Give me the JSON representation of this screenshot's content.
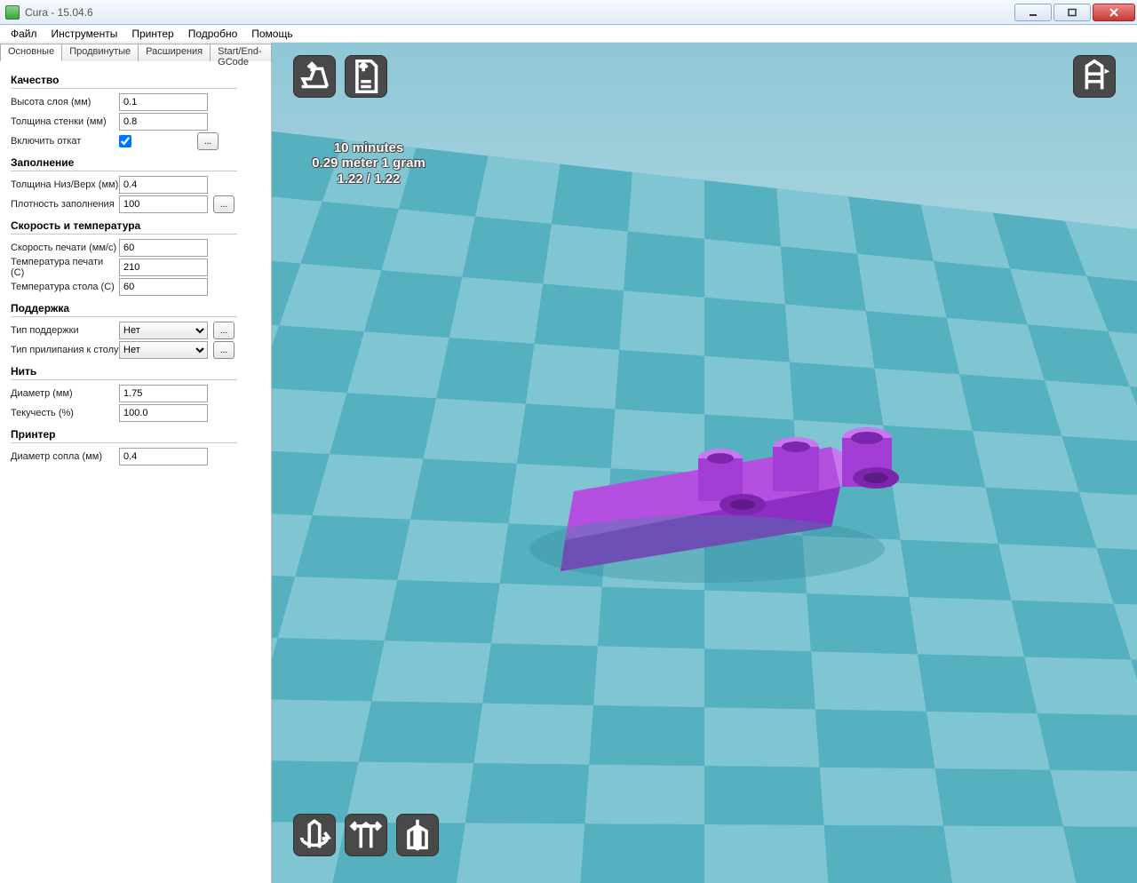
{
  "window": {
    "title": "Cura - 15.04.6"
  },
  "menu": [
    "Файл",
    "Инструменты",
    "Принтер",
    "Подробно",
    "Помощь"
  ],
  "tabs": [
    "Основные",
    "Продвинутые",
    "Расширения",
    "Start/End-GCode"
  ],
  "active_tab": 0,
  "settings": {
    "quality": {
      "title": "Качество",
      "layer_label": "Высота слоя (мм)",
      "layer_value": "0.1",
      "shell_label": "Толщина стенки (мм)",
      "shell_value": "0.8",
      "retract_label": "Включить откат",
      "retract_checked": true
    },
    "fill": {
      "title": "Заполнение",
      "topbot_label": "Толщина Низ/Верх (мм)",
      "topbot_value": "0.4",
      "density_label": "Плотность заполнения",
      "density_value": "100"
    },
    "speedtemp": {
      "title": "Скорость и температура",
      "speed_label": "Скорость печати (мм/с)",
      "speed_value": "60",
      "temp_label": "Температура печати (C)",
      "temp_value": "210",
      "bed_label": "Температура стола (C)",
      "bed_value": "60"
    },
    "support": {
      "title": "Поддержка",
      "type_label": "Тип поддержки",
      "type_value": "Нет",
      "adh_label": "Тип прилипания к столу",
      "adh_value": "Нет"
    },
    "filament": {
      "title": "Нить",
      "dia_label": "Диаметр (мм)",
      "dia_value": "1.75",
      "flow_label": "Текучесть (%)",
      "flow_value": "100.0"
    },
    "machine": {
      "title": "Принтер",
      "nozzle_label": "Диаметр сопла (мм)",
      "nozzle_value": "0.4"
    }
  },
  "hud": {
    "line1": "10 minutes",
    "line2": "0.29 meter 1 gram",
    "line3": "1.22 / 1.22"
  },
  "misc": {
    "dots": "..."
  }
}
